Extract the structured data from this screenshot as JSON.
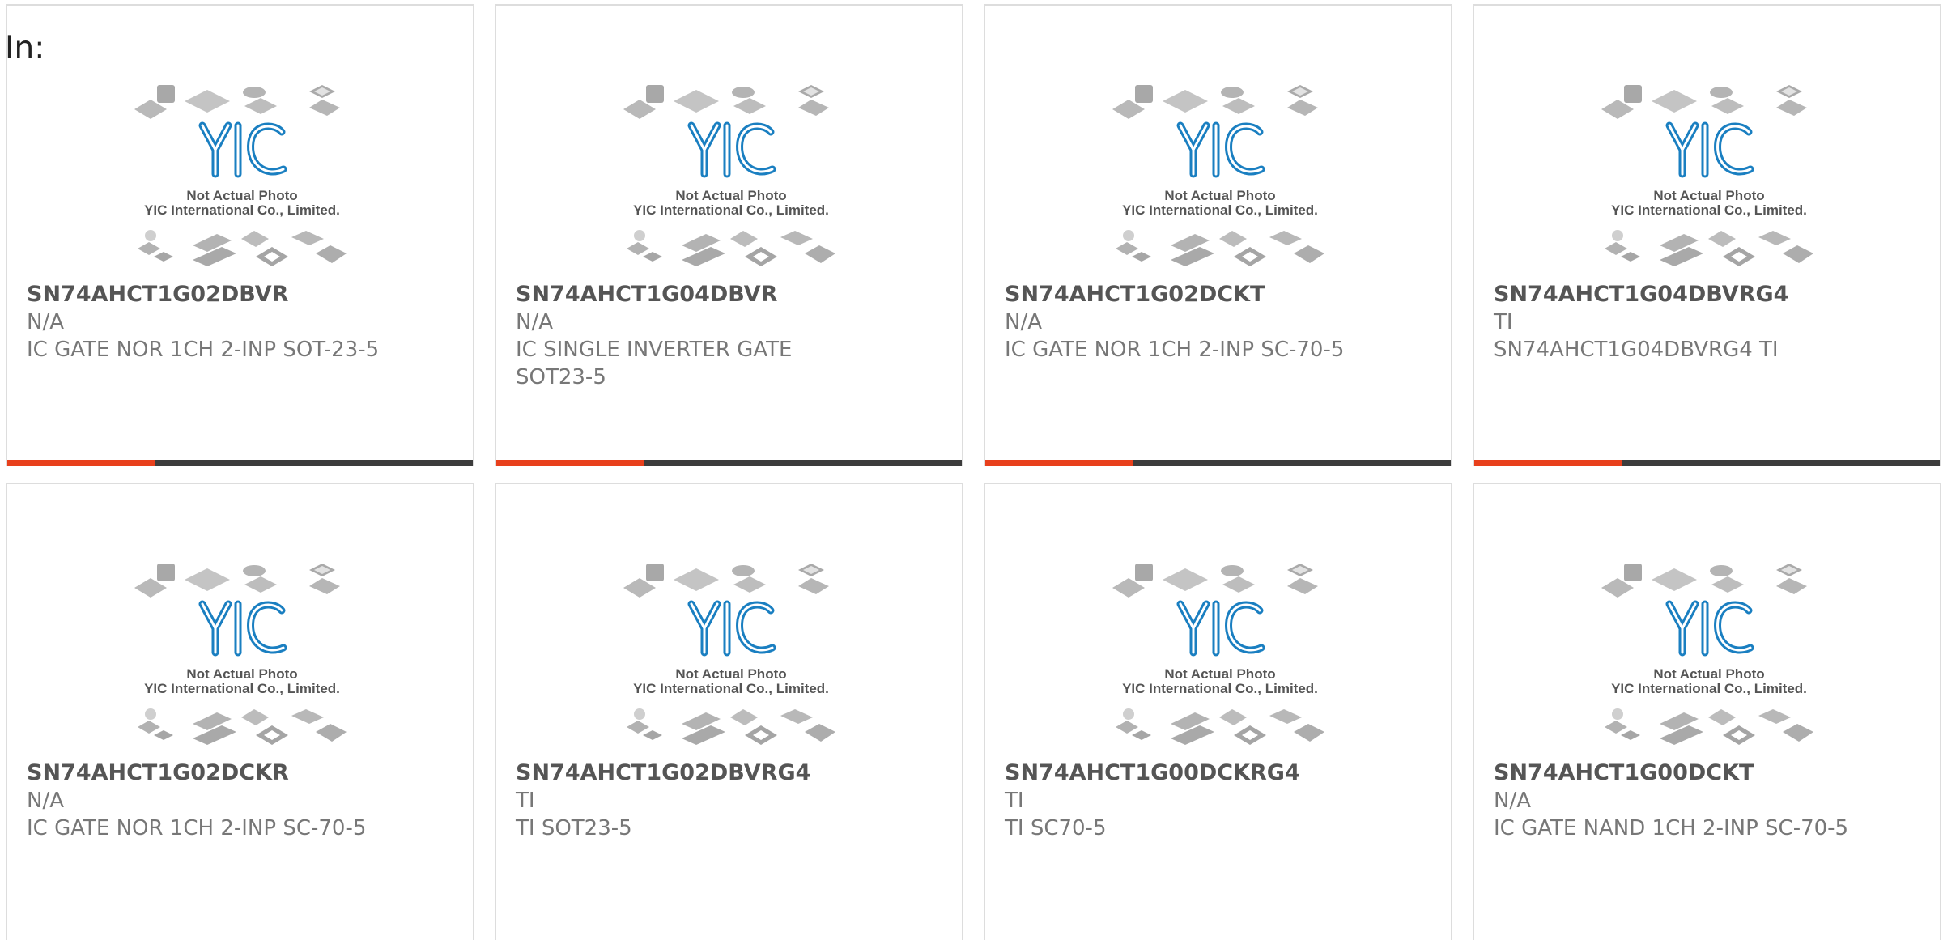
{
  "heading": "In:",
  "placeholder": {
    "caption_line1": "Not Actual Photo",
    "caption_line2": "YIC International Co., Limited.",
    "logo_text": "YIC"
  },
  "colors": {
    "accent": "#e8401c",
    "bar_dark": "#3c3c3c",
    "logo_blue": "#1a7fc1"
  },
  "products": [
    {
      "part_no": "SN74AHCT1G02DBVR",
      "manufacturer": "N/A",
      "description": "IC GATE NOR 1CH 2-INP SOT-23-5"
    },
    {
      "part_no": "SN74AHCT1G04DBVR",
      "manufacturer": "N/A",
      "description": "IC SINGLE INVERTER GATE SOT23-5"
    },
    {
      "part_no": "SN74AHCT1G02DCKT",
      "manufacturer": "N/A",
      "description": "IC GATE NOR 1CH 2-INP SC-70-5"
    },
    {
      "part_no": "SN74AHCT1G04DBVRG4",
      "manufacturer": "TI",
      "description": "SN74AHCT1G04DBVRG4 TI"
    },
    {
      "part_no": "SN74AHCT1G02DCKR",
      "manufacturer": "N/A",
      "description": "IC GATE NOR 1CH 2-INP SC-70-5"
    },
    {
      "part_no": "SN74AHCT1G02DBVRG4",
      "manufacturer": "TI",
      "description": "TI SOT23-5"
    },
    {
      "part_no": "SN74AHCT1G00DCKRG4",
      "manufacturer": "TI",
      "description": "TI SC70-5"
    },
    {
      "part_no": "SN74AHCT1G00DCKT",
      "manufacturer": "N/A",
      "description": "IC GATE NAND 1CH 2-INP SC-70-5"
    }
  ]
}
